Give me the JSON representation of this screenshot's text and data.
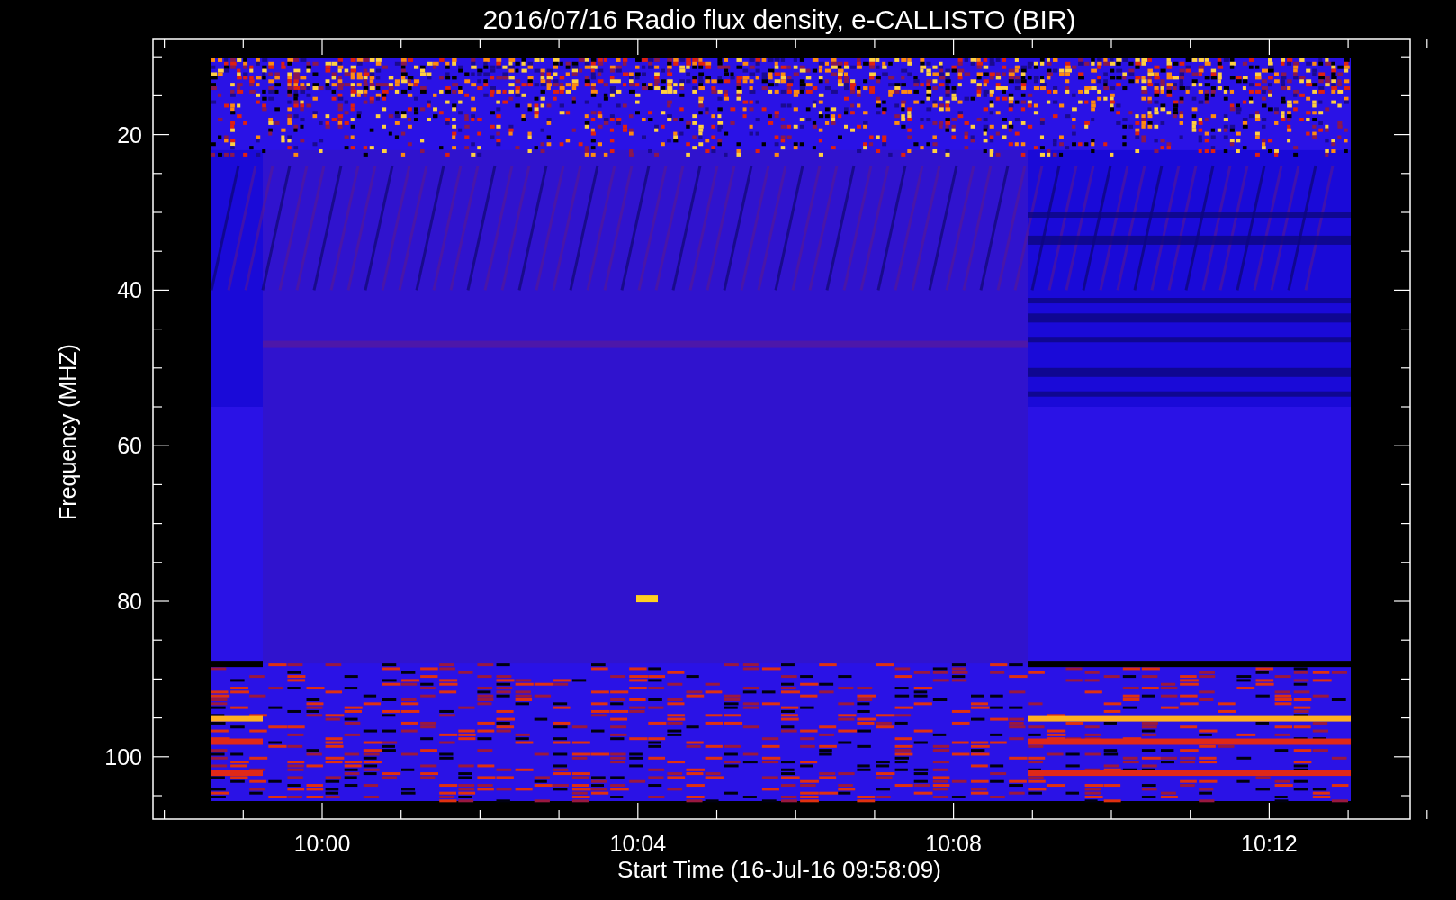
{
  "title": "2016/07/16  Radio flux density, e-CALLISTO (BIR)",
  "y_axis": {
    "label": "Frequency (MHZ)",
    "tick_labels": [
      "20",
      "40",
      "60",
      "80",
      "100"
    ]
  },
  "x_axis": {
    "label": "Start Time (16-Jul-16 09:58:09)",
    "tick_labels": [
      "10:00",
      "10:04",
      "10:08",
      "10:12"
    ]
  }
}
